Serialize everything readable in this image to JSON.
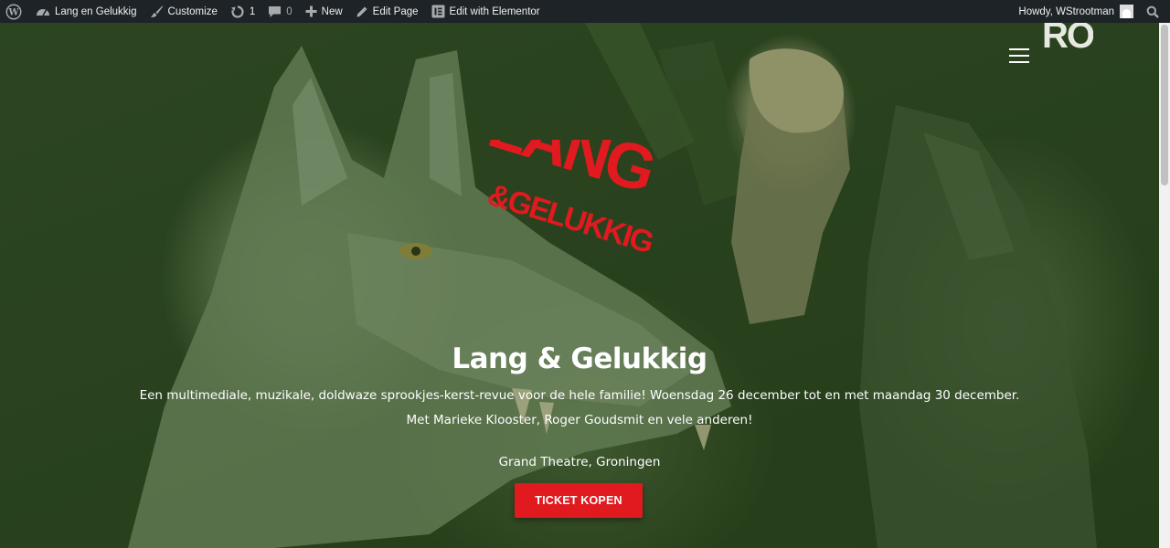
{
  "admin_bar": {
    "site_name": "Lang en Gelukkig",
    "customize": "Customize",
    "updates_count": "1",
    "comments_count": "0",
    "new": "New",
    "edit_page": "Edit Page",
    "edit_elementor": "Edit with Elementor",
    "greeting": "Howdy, WStrootman"
  },
  "header": {
    "logo_text": "RO",
    "menu_icon": "hamburger-icon"
  },
  "hero": {
    "show_logo": {
      "line1": "LANG",
      "line2": "&GELUKKIG"
    },
    "title": "Lang & Gelukkig",
    "description_line1": "Een multimediale, muzikale, doldwaze sprookjes-kerst-revue voor de hele familie! Woensdag 26 december tot en met maandag 30 december.",
    "description_line2": "Met Marieke Klooster, Roger Goudsmit en vele anderen!",
    "venue": "Grand Theatre, Groningen",
    "cta_label": "TICKET KOPEN"
  },
  "colors": {
    "admin_bar": "#1d2327",
    "accent_red": "#e01a1f",
    "overlay_green": "#284b16"
  }
}
